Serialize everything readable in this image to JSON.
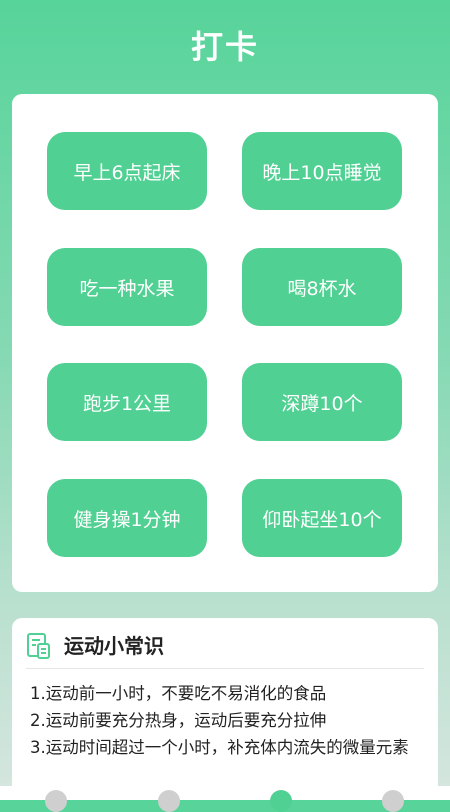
{
  "header": {
    "title": "打卡"
  },
  "checkins": [
    {
      "label": "早上6点起床"
    },
    {
      "label": "晚上10点睡觉"
    },
    {
      "label": "吃一种水果"
    },
    {
      "label": "喝8杯水"
    },
    {
      "label": "跑步1公里"
    },
    {
      "label": "深蹲10个"
    },
    {
      "label": "健身操1分钟"
    },
    {
      "label": "仰卧起坐10个"
    }
  ],
  "tips": {
    "icon": "document-icon",
    "title": "运动小常识",
    "items": [
      "1.运动前一小时，不要吃不易消化的食品",
      "2.运动前要充分热身，运动后要充分拉伸",
      "3.运动时间超过一个小时，补充体内流失的微量元素"
    ]
  },
  "bottom_nav": {
    "items": [
      {
        "icon": "home-icon",
        "active": false
      },
      {
        "icon": "discover-icon",
        "active": false
      },
      {
        "icon": "checkin-icon",
        "active": true
      },
      {
        "icon": "profile-icon",
        "active": false
      }
    ]
  },
  "colors": {
    "accent": "#50d093",
    "background_top": "#57d49a"
  }
}
